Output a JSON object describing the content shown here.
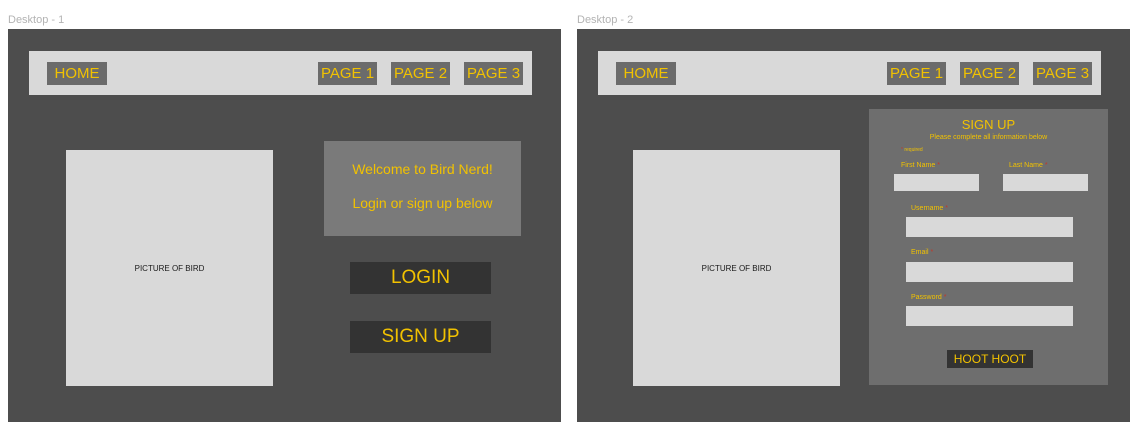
{
  "frame1": {
    "label": "Desktop - 1",
    "nav": {
      "home": "HOME",
      "page1": "PAGE 1",
      "page2": "PAGE 2",
      "page3": "PAGE 3"
    },
    "bird_picture": "PICTURE OF BIRD",
    "welcome_line1": "Welcome to Bird Nerd!",
    "welcome_line2": "Login or sign up below",
    "login_label": "LOGIN",
    "signup_label": "SIGN UP"
  },
  "frame2": {
    "label": "Desktop - 2",
    "nav": {
      "home": "HOME",
      "page1": "PAGE 1",
      "page2": "PAGE 2",
      "page3": "PAGE 3"
    },
    "bird_picture": "PICTURE OF BIRD",
    "signup": {
      "title": "SIGN UP",
      "subtitle": "Please complete all information below",
      "required_note": "required",
      "required_marker": "*",
      "first_name_label": "First Name",
      "last_name_label": "Last Name",
      "username_label": "Username",
      "email_label": "Email",
      "password_label": "Password",
      "submit_label": "HOOT HOOT"
    }
  },
  "colors": {
    "frame_bg": "#4d4d4d",
    "accent_text": "#f2c200",
    "required_star": "#c0392b"
  }
}
